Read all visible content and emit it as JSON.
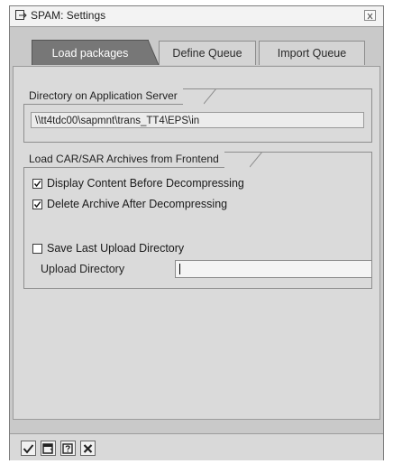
{
  "window": {
    "title": "SPAM: Settings"
  },
  "tabs": [
    {
      "label": "Load packages",
      "active": true
    },
    {
      "label": "Define Queue",
      "active": false
    },
    {
      "label": "Import Queue",
      "active": false
    }
  ],
  "app_server_group": {
    "label": "Directory on Application Server",
    "path": "\\\\tt4tdc00\\sapmnt\\trans_TT4\\EPS\\in"
  },
  "frontend_group": {
    "label": "Load CAR/SAR Archives from Frontend",
    "options": [
      {
        "label": "Display Content Before Decompressing",
        "checked": true
      },
      {
        "label": "Delete Archive After Decompressing",
        "checked": true
      },
      {
        "label": "Save Last Upload Directory",
        "checked": false
      }
    ],
    "upload_label": "Upload Directory",
    "upload_value": ""
  },
  "footer": {
    "icons": [
      "checkmark-icon",
      "save-window-icon",
      "help-icon",
      "cancel-icon"
    ]
  },
  "colors": {
    "active_tab": "#777777",
    "window_bg": "#c9c9c9",
    "panel_bg": "#dadada"
  }
}
